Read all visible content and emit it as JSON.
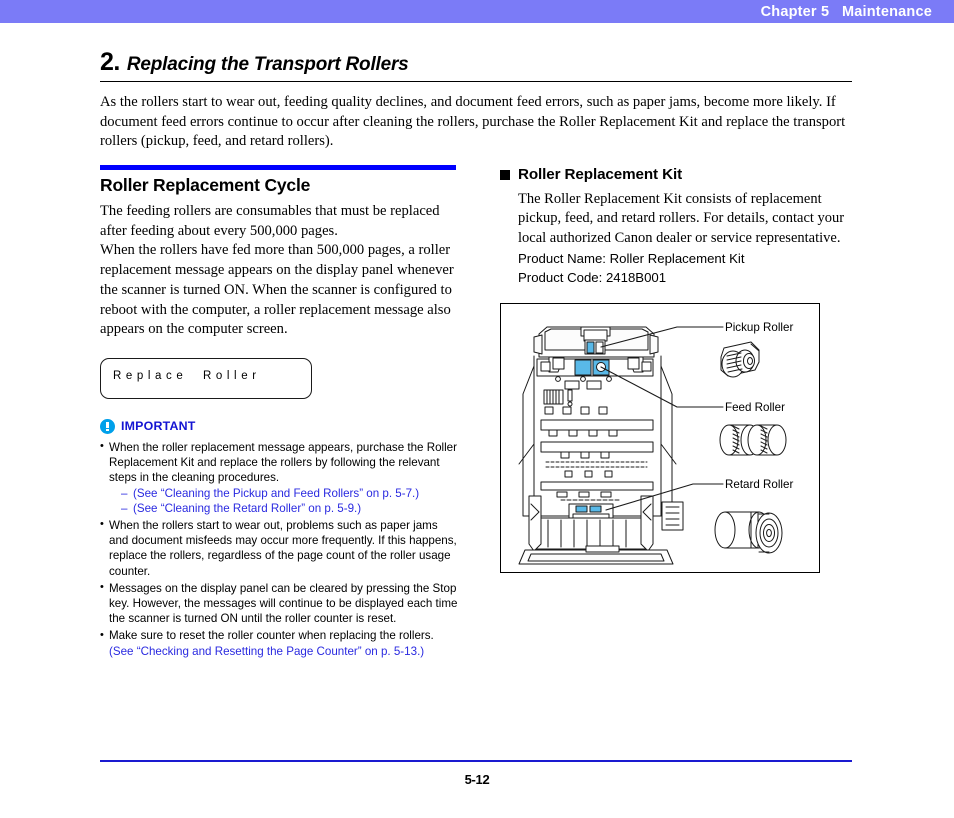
{
  "header": {
    "chapter": "Chapter 5   Maintenance"
  },
  "section": {
    "number": "2.",
    "title": "Replacing the Transport Rollers",
    "intro": "As the rollers start to wear out, feeding quality declines, and document feed errors, such as paper jams, become more likely. If document feed errors continue to occur after cleaning the rollers, purchase the Roller Replacement Kit and replace the transport rollers (pickup, feed, and retard rollers)."
  },
  "left_column": {
    "heading": "Roller Replacement Cycle",
    "paragraph1": "The feeding rollers are consumables that must be replaced after feeding about every 500,000 pages.",
    "paragraph2": "When the rollers have fed more than 500,000 pages, a roller replacement message appears on the display panel whenever the scanner is turned ON. When the scanner is configured to reboot with the computer, a roller replacement message also appears on the computer screen.",
    "lcd_message": "Replace  Roller",
    "important": {
      "label": "IMPORTANT",
      "notes": [
        {
          "text": "When the roller replacement message appears, purchase the Roller Replacement Kit and replace the rollers by following the relevant steps in the cleaning procedures.",
          "sub_links": [
            "(See “Cleaning the Pickup and Feed Rollers” on p. 5-7.)",
            "(See “Cleaning the Retard Roller” on p. 5-9.)"
          ]
        },
        {
          "text": "When the rollers start to wear out, problems such as paper jams and document misfeeds may occur more frequently. If this happens, replace the rollers, regardless of the page count of the roller usage counter.",
          "sub_links": []
        },
        {
          "text": "Messages on the display panel can be cleared by pressing the Stop key. However, the messages will continue to be displayed each time the scanner is turned ON until the roller counter is reset.",
          "sub_links": []
        },
        {
          "text": "Make sure to reset the roller counter when replacing the rollers.",
          "link": "(See “Checking and Resetting the Page Counter” on p. 5-13.)",
          "sub_links": []
        }
      ]
    }
  },
  "right_column": {
    "heading": "Roller Replacement Kit",
    "paragraph": "The Roller Replacement Kit consists of replacement pickup, feed, and retard rollers. For details, contact your local authorized Canon dealer or service representative.",
    "product_name": "Product Name: Roller Replacement Kit",
    "product_code": "Product Code: 2418B001",
    "figure": {
      "labels": [
        "Pickup Roller",
        "Feed Roller",
        "Retard Roller"
      ]
    }
  },
  "footer": {
    "page_number": "5-12"
  },
  "colors": {
    "header_bg": "#7b7bf7",
    "rule_blue": "#0000ff",
    "link_blue": "#2a2ae0",
    "important_icon": "#00a0ea",
    "highlight_blue": "#59b9e8"
  }
}
